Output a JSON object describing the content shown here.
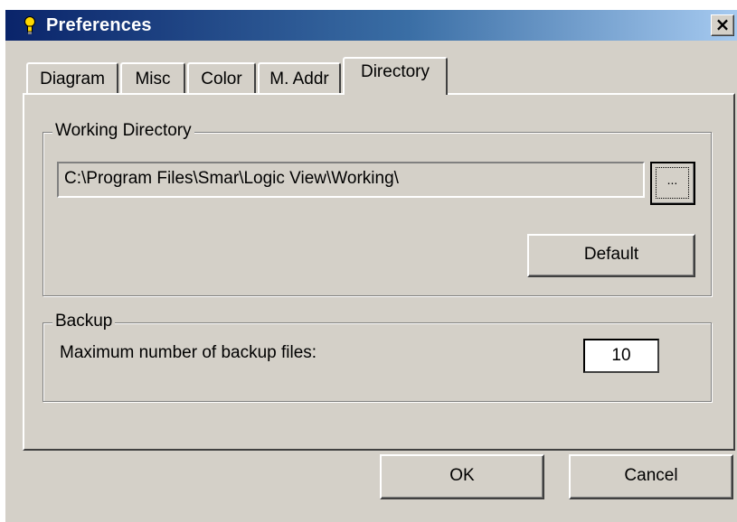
{
  "window": {
    "title": "Preferences",
    "close_label": "×"
  },
  "tabs": [
    {
      "label": "Diagram"
    },
    {
      "label": "Misc"
    },
    {
      "label": "Color"
    },
    {
      "label": "M. Addr"
    },
    {
      "label": "Directory",
      "active": true
    }
  ],
  "working_directory": {
    "group_label": "Working Directory",
    "path": "C:\\Program Files\\Smar\\Logic View\\Working\\",
    "browse_label": "...",
    "default_label": "Default"
  },
  "backup": {
    "group_label": "Backup",
    "max_files_label": "Maximum number of backup files:",
    "max_files_value": "10"
  },
  "footer": {
    "ok_label": "OK",
    "cancel_label": "Cancel"
  },
  "icons": {
    "title_icon": "lightbulb-icon"
  },
  "colors": {
    "title_start": "#0a246a",
    "title_end": "#a6caf0",
    "face": "#d4d0c8"
  }
}
